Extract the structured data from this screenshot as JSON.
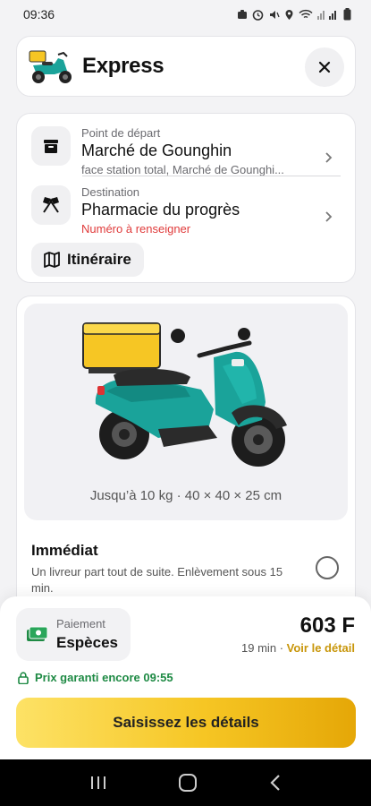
{
  "status_bar": {
    "time": "09:36"
  },
  "header": {
    "title": "Express"
  },
  "route": {
    "pickup": {
      "label": "Point de départ",
      "name": "Marché de Gounghin",
      "detail": "face station total, Marché de Gounghi..."
    },
    "destination": {
      "label": "Destination",
      "name": "Pharmacie du progrès",
      "warning": "Numéro à renseigner"
    },
    "itinerary_label": "Itinéraire"
  },
  "vehicle": {
    "spec": "Jusqu’à 10 kg · 40 × 40 × 25 cm",
    "option": {
      "title": "Immédiat",
      "description": "Un livreur part tout de suite. Enlèvement sous 15 min.",
      "selected": false
    }
  },
  "checkout": {
    "payment_label": "Paiement",
    "payment_value": "Espèces",
    "price": "603 F",
    "eta": "19 min",
    "separator": "·",
    "detail_link": "Voir le détail",
    "guarantee": "Prix garanti encore 09:55",
    "cta": "Saisissez les détails"
  },
  "colors": {
    "accent": "#f6c624",
    "warning": "#e03b3b",
    "success": "#1e8a44",
    "scooter": "#1aa39a"
  },
  "icons": [
    "box-icon",
    "flags-icon",
    "map-icon",
    "close-icon",
    "chevron-right-icon",
    "cash-icon",
    "lock-icon"
  ]
}
